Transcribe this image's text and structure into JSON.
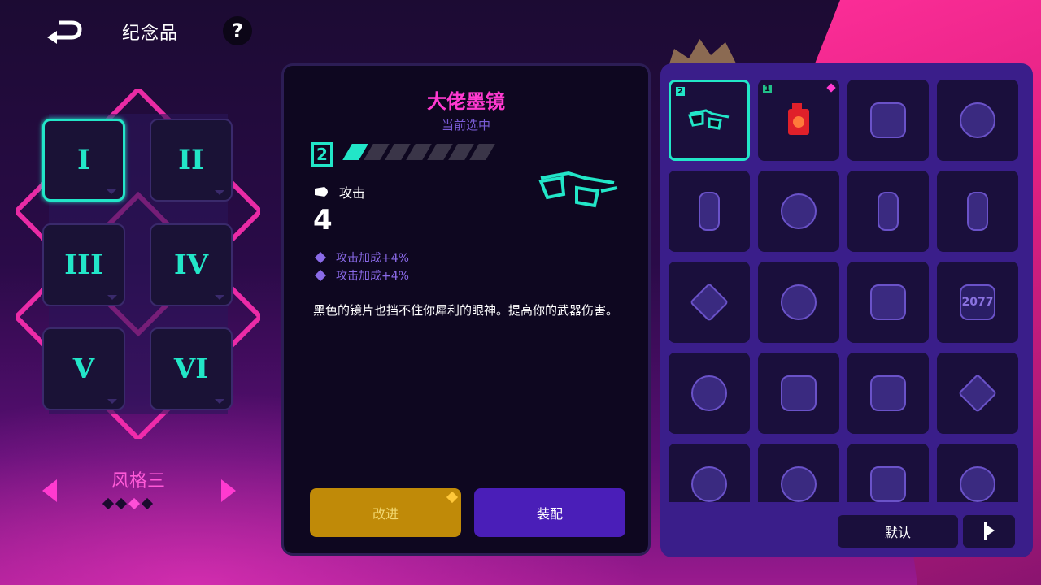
{
  "header": {
    "title": "纪念品",
    "help_label": "?"
  },
  "styles": {
    "current_name": "风格三",
    "page_count": 4,
    "page_index": 2,
    "slots": [
      {
        "label": "I",
        "active": true
      },
      {
        "label": "II",
        "active": false
      },
      {
        "label": "III",
        "active": false
      },
      {
        "label": "IV",
        "active": false
      },
      {
        "label": "V",
        "active": false
      },
      {
        "label": "VI",
        "active": false
      }
    ]
  },
  "detail": {
    "name": "大佬墨镜",
    "status": "当前选中",
    "level": "2",
    "pips_filled": 1,
    "pips_total": 7,
    "stat_label": "攻击",
    "stat_value": "4",
    "bonuses": [
      "攻击加成+4%",
      "攻击加成+4%"
    ],
    "description": "黑色的镜片也挡不住你犀利的眼神。提高你的武器伤害。",
    "upgrade_label": "改进",
    "equip_label": "装配"
  },
  "inventory": {
    "default_label": "默认",
    "items": [
      {
        "icon": "sunglasses-icon",
        "tag": "2",
        "selected": true
      },
      {
        "icon": "fuel-can-icon",
        "tag": "1",
        "gem": true
      },
      {
        "icon": "gadget-icon"
      },
      {
        "icon": "heart-crystal-icon"
      },
      {
        "icon": "card-icon"
      },
      {
        "icon": "bear-icon"
      },
      {
        "icon": "fang-icon"
      },
      {
        "icon": "capsule-icon"
      },
      {
        "icon": "winged-bullet-icon"
      },
      {
        "icon": "spartan-helmet-icon"
      },
      {
        "icon": "watch-icon"
      },
      {
        "icon": "2077-badge-icon",
        "text": "2077"
      },
      {
        "icon": "wreath-icon"
      },
      {
        "icon": "glove-icon"
      },
      {
        "icon": "chip-icon"
      },
      {
        "icon": "ice-cream-icon"
      },
      {
        "icon": "lion-icon"
      },
      {
        "icon": "mask-icon"
      },
      {
        "icon": "trophy-icon"
      },
      {
        "icon": "gourd-icon"
      }
    ]
  }
}
